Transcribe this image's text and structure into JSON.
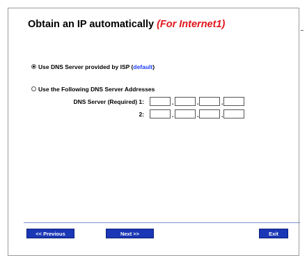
{
  "title": {
    "main": "Obtain an IP automatically",
    "highlight": "(For Internet1)"
  },
  "dns_options": {
    "isp": {
      "label": "Use DNS Server provided by ISP (",
      "link": "default",
      "suffix": ")",
      "selected": true
    },
    "manual": {
      "label": "Use the Following DNS Server Addresses",
      "selected": false
    }
  },
  "dns_fields": {
    "server1_label": "DNS Server (Required) 1:",
    "server2_label": "2:",
    "separator": "."
  },
  "buttons": {
    "previous": "<< Previous",
    "next": "Next >>",
    "exit": "Exit"
  }
}
